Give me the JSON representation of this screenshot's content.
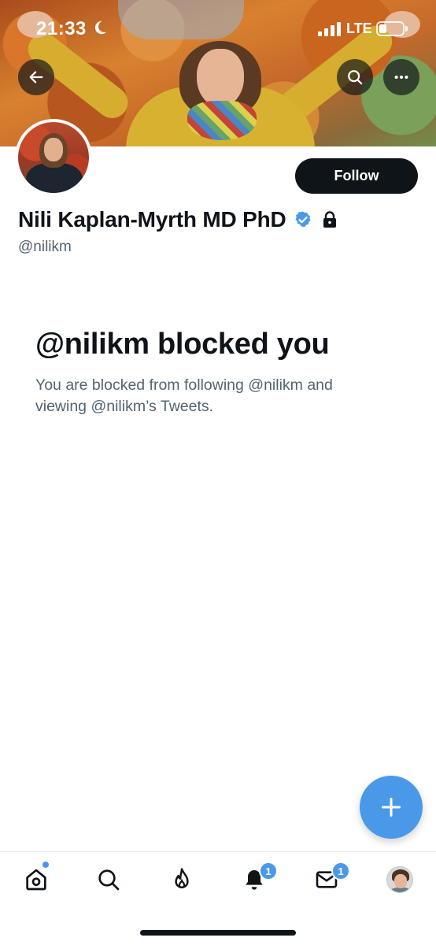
{
  "status_bar": {
    "time": "21:33",
    "network": "LTE",
    "icons": [
      "moon-icon",
      "signal-icon",
      "battery-icon"
    ]
  },
  "header": {
    "icons": [
      "back-arrow-icon",
      "search-icon",
      "more-icon"
    ]
  },
  "profile": {
    "display_name": "Nili Kaplan-Myrth MD PhD",
    "handle": "@nilikm",
    "follow_label": "Follow",
    "badges": [
      "verified-icon",
      "lock-icon"
    ]
  },
  "blocked": {
    "title": "@nilikm blocked you",
    "description": "You are blocked from following @nilikm and viewing @nilikm’s Tweets."
  },
  "fab": {
    "icon": "plus-icon"
  },
  "bottom_nav": {
    "items": [
      {
        "icon": "home-icon",
        "has_dot": true
      },
      {
        "icon": "search-icon"
      },
      {
        "icon": "spaces-icon"
      },
      {
        "icon": "bell-icon",
        "badge": "1"
      },
      {
        "icon": "mail-icon",
        "badge": "1"
      },
      {
        "icon": "avatar"
      }
    ]
  },
  "colors": {
    "accent": "#4a99e9",
    "text_primary": "#0f1419",
    "text_secondary": "#536471",
    "follow_bg": "#0f1419"
  }
}
